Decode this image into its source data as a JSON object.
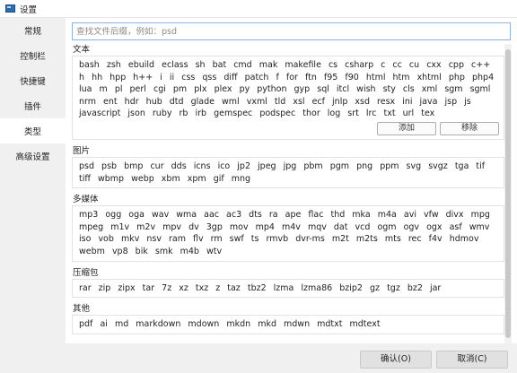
{
  "window": {
    "title": "设置"
  },
  "sidebar": {
    "items": [
      {
        "label": "常规"
      },
      {
        "label": "控制栏"
      },
      {
        "label": "快捷键"
      },
      {
        "label": "插件"
      },
      {
        "label": "类型"
      },
      {
        "label": "高级设置"
      }
    ],
    "active_index": 4
  },
  "search": {
    "placeholder": "查找文件后缀，例如：psd",
    "value": ""
  },
  "groups": [
    {
      "title": "文本",
      "extensions": [
        "bash",
        "zsh",
        "ebuild",
        "eclass",
        "sh",
        "bat",
        "cmd",
        "mak",
        "makefile",
        "cs",
        "csharp",
        "c",
        "cc",
        "cu",
        "cxx",
        "cpp",
        "c++",
        "h",
        "hh",
        "hpp",
        "h++",
        "i",
        "ii",
        "css",
        "qss",
        "diff",
        "patch",
        "f",
        "for",
        "ftn",
        "f95",
        "f90",
        "html",
        "htm",
        "xhtml",
        "php",
        "php4",
        "lua",
        "m",
        "pl",
        "perl",
        "cgi",
        "pm",
        "plx",
        "plex",
        "py",
        "python",
        "gyp",
        "sql",
        "itcl",
        "wish",
        "sty",
        "cls",
        "xml",
        "sgm",
        "sgml",
        "nrm",
        "ent",
        "hdr",
        "hub",
        "dtd",
        "glade",
        "wml",
        "vxml",
        "tld",
        "xsl",
        "ecf",
        "jnlp",
        "xsd",
        "resx",
        "ini",
        "java",
        "jsp",
        "js",
        "javascript",
        "json",
        "ruby",
        "rb",
        "irb",
        "gemspec",
        "podspec",
        "thor",
        "log",
        "srt",
        "lrc",
        "txt",
        "url",
        "tex"
      ],
      "add_label": "添加",
      "remove_label": "移除"
    },
    {
      "title": "图片",
      "extensions": [
        "psd",
        "psb",
        "bmp",
        "cur",
        "dds",
        "icns",
        "ico",
        "jp2",
        "jpeg",
        "jpg",
        "pbm",
        "pgm",
        "png",
        "ppm",
        "svg",
        "svgz",
        "tga",
        "tif",
        "tiff",
        "wbmp",
        "webp",
        "xbm",
        "xpm",
        "gif",
        "mng"
      ]
    },
    {
      "title": "多媒体",
      "extensions": [
        "mp3",
        "ogg",
        "oga",
        "wav",
        "wma",
        "aac",
        "ac3",
        "dts",
        "ra",
        "ape",
        "flac",
        "thd",
        "mka",
        "m4a",
        "avi",
        "vfw",
        "divx",
        "mpg",
        "mpeg",
        "m1v",
        "m2v",
        "mpv",
        "dv",
        "3gp",
        "mov",
        "mp4",
        "m4v",
        "mqv",
        "dat",
        "vcd",
        "ogm",
        "ogv",
        "ogx",
        "asf",
        "wmv",
        "iso",
        "vob",
        "mkv",
        "nsv",
        "ram",
        "flv",
        "rm",
        "swf",
        "ts",
        "rmvb",
        "dvr-ms",
        "m2t",
        "m2ts",
        "mts",
        "rec",
        "f4v",
        "hdmov",
        "webm",
        "vp8",
        "bik",
        "smk",
        "m4b",
        "wtv"
      ]
    },
    {
      "title": "压缩包",
      "extensions": [
        "rar",
        "zip",
        "zipx",
        "tar",
        "7z",
        "xz",
        "txz",
        "z",
        "taz",
        "tbz2",
        "lzma",
        "lzma86",
        "bzip2",
        "gz",
        "tgz",
        "bz2",
        "jar"
      ]
    },
    {
      "title": "其他",
      "extensions": [
        "pdf",
        "ai",
        "md",
        "markdown",
        "mdown",
        "mkdn",
        "mkd",
        "mdwn",
        "mdtxt",
        "mdtext"
      ]
    }
  ],
  "footer": {
    "ok_label": "确认(O)",
    "cancel_label": "取消(C)"
  }
}
